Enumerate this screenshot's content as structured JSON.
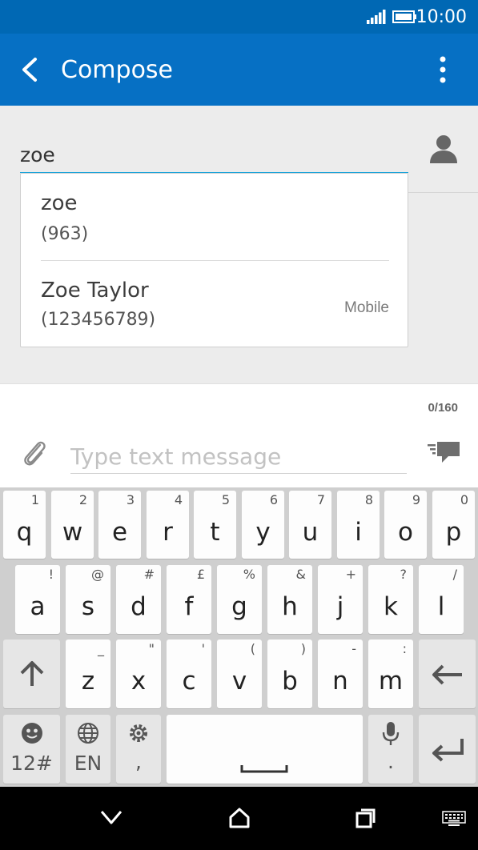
{
  "status_bar": {
    "time": "10:00"
  },
  "app_bar": {
    "title": "Compose"
  },
  "recipient": {
    "value": "zoe",
    "suggestions": [
      {
        "name": "zoe",
        "number": "(963)",
        "type": ""
      },
      {
        "name": "Zoe Taylor",
        "number": "(123456789)",
        "type": "Mobile"
      }
    ]
  },
  "message": {
    "char_count": "0/160",
    "placeholder": "Type text message"
  },
  "keyboard": {
    "row1": [
      {
        "k": "q",
        "h": "1"
      },
      {
        "k": "w",
        "h": "2"
      },
      {
        "k": "e",
        "h": "3"
      },
      {
        "k": "r",
        "h": "4"
      },
      {
        "k": "t",
        "h": "5"
      },
      {
        "k": "y",
        "h": "6"
      },
      {
        "k": "u",
        "h": "7"
      },
      {
        "k": "i",
        "h": "8"
      },
      {
        "k": "o",
        "h": "9"
      },
      {
        "k": "p",
        "h": "0"
      }
    ],
    "row2": [
      {
        "k": "a",
        "h": "!"
      },
      {
        "k": "s",
        "h": "@"
      },
      {
        "k": "d",
        "h": "#"
      },
      {
        "k": "f",
        "h": "£"
      },
      {
        "k": "g",
        "h": "%"
      },
      {
        "k": "h",
        "h": "&"
      },
      {
        "k": "j",
        "h": "+"
      },
      {
        "k": "k",
        "h": "?"
      },
      {
        "k": "l",
        "h": "/"
      }
    ],
    "row3": [
      {
        "k": "z",
        "h": "_"
      },
      {
        "k": "x",
        "h": "\""
      },
      {
        "k": "c",
        "h": "'"
      },
      {
        "k": "v",
        "h": "("
      },
      {
        "k": "b",
        "h": ")"
      },
      {
        "k": "n",
        "h": "-"
      },
      {
        "k": "m",
        "h": ":"
      }
    ],
    "symbols_label": "12#",
    "language_label": "EN",
    "comma_label": ",",
    "period_label": "."
  },
  "icons": {
    "back": "back-arrow-icon",
    "overflow": "overflow-menu-icon",
    "contact": "contact-person-icon",
    "attach": "paperclip-icon",
    "send": "send-message-icon"
  },
  "colors": {
    "accent": "#0670c4",
    "status_bar": "#0068b4",
    "input_underline": "#1aa3d9"
  }
}
